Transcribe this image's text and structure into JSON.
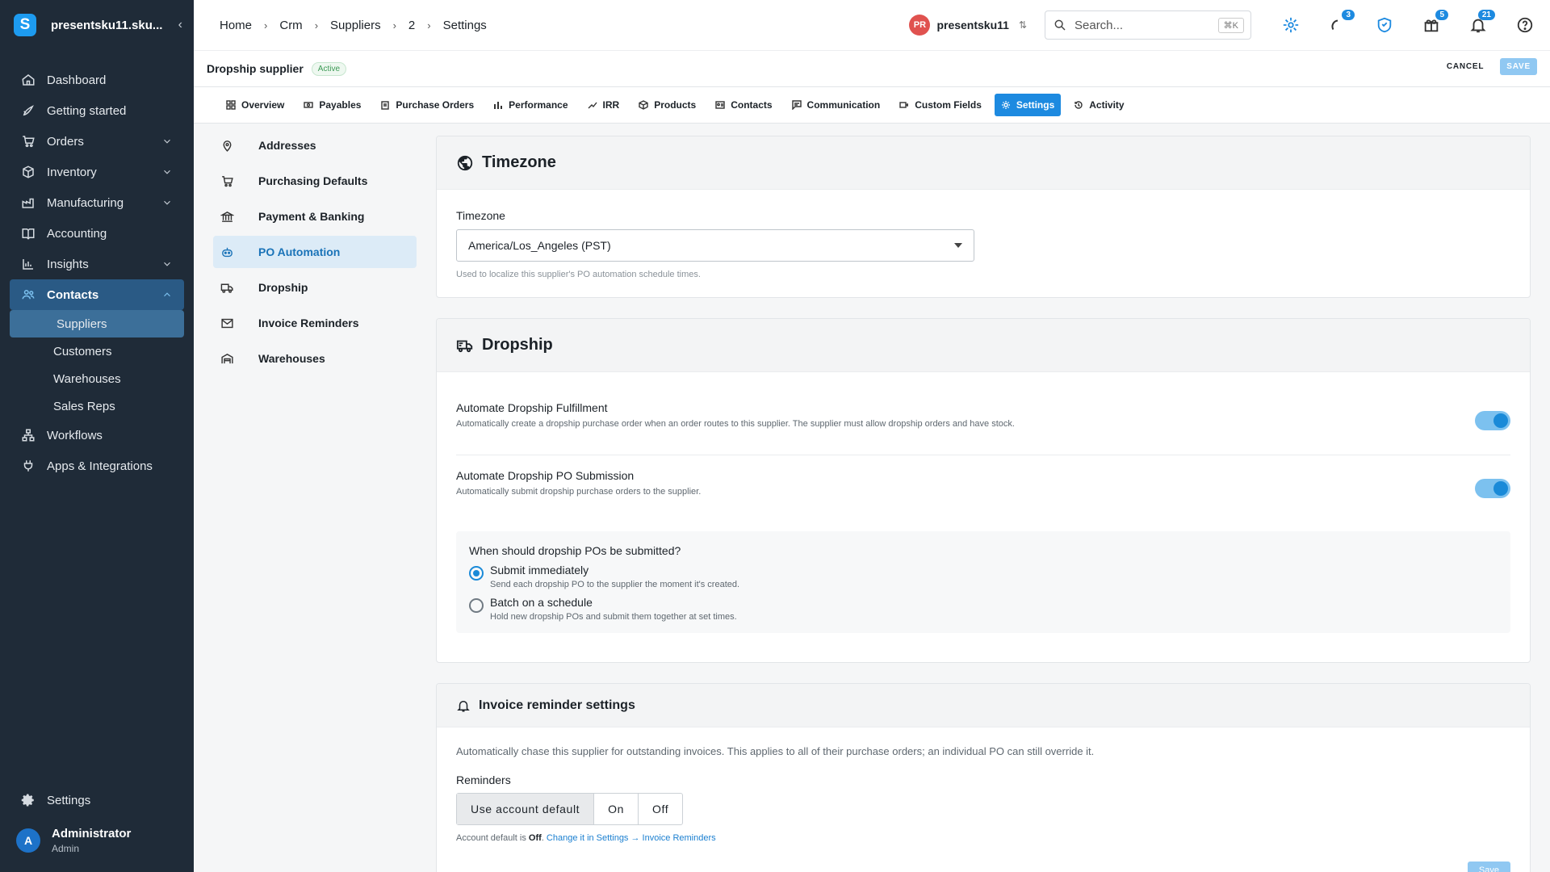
{
  "sidebar": {
    "org_name": "presentsku11.sku...",
    "logo_letter": "S",
    "collapse_glyph": "‹",
    "items": [
      {
        "label": "Dashboard",
        "icon": "home-icon"
      },
      {
        "label": "Getting started",
        "icon": "rocket-icon"
      },
      {
        "label": "Orders",
        "icon": "cart-icon"
      },
      {
        "label": "Inventory",
        "icon": "box-icon"
      },
      {
        "label": "Manufacturing",
        "icon": "factory-icon"
      },
      {
        "label": "Accounting",
        "icon": "book-icon"
      },
      {
        "label": "Insights",
        "icon": "bar-chart-icon"
      },
      {
        "label": "Contacts",
        "icon": "people-icon"
      },
      {
        "label": "Workflows",
        "icon": "workflow-icon"
      },
      {
        "label": "Apps & Integrations",
        "icon": "plug-icon"
      }
    ],
    "contacts_sub": [
      "Suppliers",
      "Customers",
      "Warehouses",
      "Sales Reps"
    ],
    "settings_label": "Settings",
    "user": {
      "initial": "A",
      "name": "Administrator",
      "role": "Admin"
    }
  },
  "topbar": {
    "breadcrumbs": [
      "Home",
      "Crm",
      "Suppliers",
      "2",
      "Settings"
    ],
    "breadcrumb_sep": "›",
    "account": {
      "initials": "PR",
      "name": "presentsku11"
    },
    "search": {
      "placeholder": "Search...",
      "shortcut": "⌘K"
    },
    "badges": {
      "activity": "3",
      "gift": "5",
      "notifications": "21"
    }
  },
  "record": {
    "title": "Dropship supplier",
    "status": "Active",
    "cancel_label": "CANCEL",
    "save_label": "SAVE"
  },
  "tabs": [
    {
      "label": "Overview",
      "icon": "grid-icon"
    },
    {
      "label": "Payables",
      "icon": "cash-icon"
    },
    {
      "label": "Purchase Orders",
      "icon": "clipboard-icon"
    },
    {
      "label": "Performance",
      "icon": "bars-icon"
    },
    {
      "label": "IRR",
      "icon": "trend-icon"
    },
    {
      "label": "Products",
      "icon": "package-icon"
    },
    {
      "label": "Contacts",
      "icon": "id-card-icon"
    },
    {
      "label": "Communication",
      "icon": "message-icon"
    },
    {
      "label": "Custom Fields",
      "icon": "custom-field-icon"
    },
    {
      "label": "Settings",
      "icon": "gear-icon"
    },
    {
      "label": "Activity",
      "icon": "history-icon"
    }
  ],
  "settings_menu": [
    {
      "label": "Addresses",
      "icon": "pin-icon"
    },
    {
      "label": "Purchasing Defaults",
      "icon": "cart-icon"
    },
    {
      "label": "Payment & Banking",
      "icon": "bank-icon"
    },
    {
      "label": "PO Automation",
      "icon": "robot-icon"
    },
    {
      "label": "Dropship",
      "icon": "truck-icon"
    },
    {
      "label": "Invoice Reminders",
      "icon": "mail-icon"
    },
    {
      "label": "Warehouses",
      "icon": "warehouse-icon"
    }
  ],
  "timezone_card": {
    "title": "Timezone",
    "field_label": "Timezone",
    "value": "America/Los_Angeles (PST)",
    "helper": "Used to localize this supplier's PO automation schedule times."
  },
  "dropship_card": {
    "title": "Dropship",
    "fulfillment": {
      "title": "Automate Dropship Fulfillment",
      "desc": "Automatically create a dropship purchase order when an order routes to this supplier. The supplier must allow dropship orders and have stock.",
      "enabled": true
    },
    "submission": {
      "title": "Automate Dropship PO Submission",
      "desc": "Automatically submit dropship purchase orders to the supplier.",
      "enabled": true
    },
    "question": "When should dropship POs be submitted?",
    "options": [
      {
        "title": "Submit immediately",
        "desc": "Send each dropship PO to the supplier the moment it's created.",
        "selected": true
      },
      {
        "title": "Batch on a schedule",
        "desc": "Hold new dropship POs and submit them together at set times.",
        "selected": false
      }
    ]
  },
  "invoice_card": {
    "title": "Invoice reminder settings",
    "intro": "Automatically chase this supplier for outstanding invoices. This applies to all of their purchase orders; an individual PO can still override it.",
    "reminders_label": "Reminders",
    "segments": [
      "Use account default",
      "On",
      "Off"
    ],
    "selected_segment": "Use account default",
    "default_prefix": "Account default is",
    "default_value": "Off",
    "default_period": ".",
    "link_text": "Change it in Settings → Invoice Reminders",
    "save_label": "Save"
  },
  "colors": {
    "sidebar_bg": "#1f2b38",
    "accent": "#1d8ae0",
    "active_menu_bg": "#dcebf7",
    "status_green": "#3c9a55"
  }
}
